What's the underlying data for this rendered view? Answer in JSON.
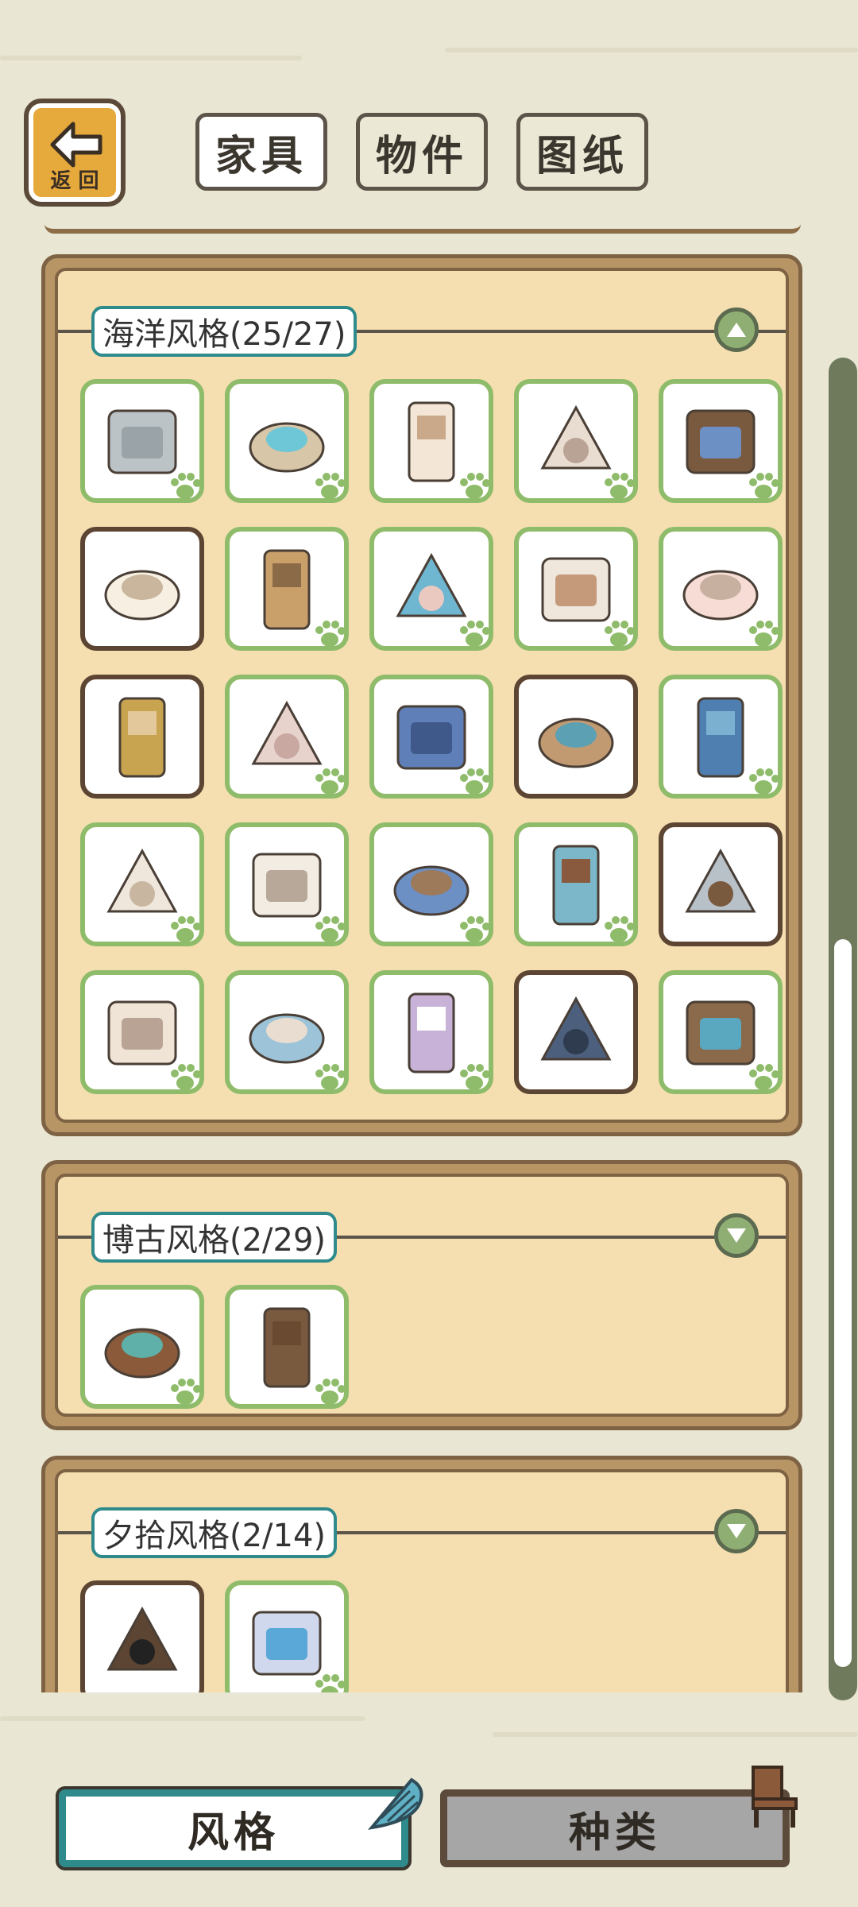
{
  "header": {
    "back_label": "返 回",
    "tabs": [
      {
        "label": "家具",
        "active": true
      },
      {
        "label": "物件",
        "active": false
      },
      {
        "label": "图纸",
        "active": false
      }
    ]
  },
  "sections": [
    {
      "title": "海洋风格(25/27)",
      "expanded": true,
      "items": [
        {
          "name": "seaside-wall",
          "locked": false
        },
        {
          "name": "beach-floor",
          "locked": false
        },
        {
          "name": "driftwood-ladder",
          "locked": false
        },
        {
          "name": "shell-arch",
          "locked": false
        },
        {
          "name": "porthole-door",
          "locked": false
        },
        {
          "name": "treasure-map-rug",
          "locked": true
        },
        {
          "name": "scroll-shell",
          "locked": false
        },
        {
          "name": "shell-bed",
          "locked": false
        },
        {
          "name": "sand-jar",
          "locked": false
        },
        {
          "name": "note-board",
          "locked": false
        },
        {
          "name": "shell-tray",
          "locked": true
        },
        {
          "name": "conch-stool",
          "locked": false
        },
        {
          "name": "blue-cabinet",
          "locked": false
        },
        {
          "name": "shell-jar",
          "locked": true
        },
        {
          "name": "treasure-chest",
          "locked": false
        },
        {
          "name": "clam-table",
          "locked": false
        },
        {
          "name": "shell-chair",
          "locked": false
        },
        {
          "name": "kitchen-table",
          "locked": false
        },
        {
          "name": "sink-basin",
          "locked": false
        },
        {
          "name": "surf-mirror",
          "locked": true
        },
        {
          "name": "coral-stand",
          "locked": false
        },
        {
          "name": "folding-screen",
          "locked": false
        },
        {
          "name": "candle-shell",
          "locked": false
        },
        {
          "name": "anchor-cabinet",
          "locked": true
        },
        {
          "name": "barrel-stack",
          "locked": false
        }
      ]
    },
    {
      "title": "博古风格(2/29)",
      "expanded": false,
      "items": [
        {
          "name": "low-tea-table",
          "locked": false
        },
        {
          "name": "wood-wardrobe",
          "locked": false
        }
      ]
    },
    {
      "title": "夕拾风格(2/14)",
      "expanded": false,
      "items": [
        {
          "name": "floor-lamp",
          "locked": true
        },
        {
          "name": "crystal-orb",
          "locked": false
        }
      ]
    }
  ],
  "bottom_tabs": [
    {
      "label": "风格",
      "active": true
    },
    {
      "label": "种类",
      "active": false
    }
  ],
  "colors": {
    "background": "#e9e6d3",
    "panel_fill": "#f5dfb0",
    "panel_frame": "#b89565",
    "owned_border": "#8fbc6a",
    "locked_border": "#5c4532",
    "accent_teal": "#2f8a8c",
    "toggle_green": "#8fae73"
  }
}
